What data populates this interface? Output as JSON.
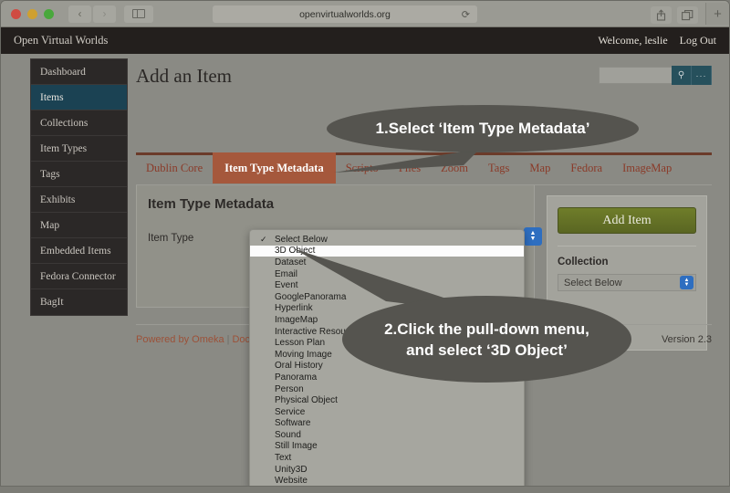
{
  "browser": {
    "url": "openvirtualworlds.org",
    "reload_icon": "reload-icon",
    "back_icon": "‹",
    "forward_icon": "›",
    "sidebar_icon": "sidebar-icon",
    "share_icon": "share-icon",
    "tabs_icon": "tabs-icon",
    "newtab_icon": "+"
  },
  "site_header": {
    "title": "Open Virtual Worlds",
    "welcome": "Welcome, leslie",
    "logout": "Log Out"
  },
  "sidebar": {
    "items": [
      {
        "label": "Dashboard",
        "active": false
      },
      {
        "label": "Items",
        "active": true
      },
      {
        "label": "Collections",
        "active": false
      },
      {
        "label": "Item Types",
        "active": false
      },
      {
        "label": "Tags",
        "active": false
      },
      {
        "label": "Exhibits",
        "active": false
      },
      {
        "label": "Map",
        "active": false
      },
      {
        "label": "Embedded Items",
        "active": false
      },
      {
        "label": "Fedora Connector",
        "active": false
      },
      {
        "label": "BagIt",
        "active": false
      }
    ]
  },
  "main": {
    "page_title": "Add an Item",
    "search": {
      "value": "",
      "placeholder": "",
      "search_icon": "search-icon",
      "advanced_label": "···"
    },
    "tabs": [
      {
        "label": "Dublin Core",
        "active": false
      },
      {
        "label": "Item Type Metadata",
        "active": true
      },
      {
        "label": "Scripto",
        "active": false
      },
      {
        "label": "Files",
        "active": false
      },
      {
        "label": "Zoom",
        "active": false
      },
      {
        "label": "Tags",
        "active": false
      },
      {
        "label": "Map",
        "active": false
      },
      {
        "label": "Fedora",
        "active": false
      },
      {
        "label": "ImageMap",
        "active": false
      }
    ],
    "panel": {
      "title": "Item Type Metadata",
      "field_label": "Item Type",
      "field_value": "Select Below"
    }
  },
  "side_panel": {
    "add_item_label": "Add Item",
    "collection_label": "Collection",
    "collection_value": "Select Below"
  },
  "footer": {
    "powered_by": "Powered by Omeka",
    "separator": "|",
    "documentation": "Docu",
    "version": "Version 2.3"
  },
  "dropdown": {
    "items": [
      {
        "label": "Select Below",
        "checked": true,
        "highlight": false
      },
      {
        "label": "3D Object",
        "checked": false,
        "highlight": true
      },
      {
        "label": "Dataset",
        "checked": false,
        "highlight": false
      },
      {
        "label": "Email",
        "checked": false,
        "highlight": false
      },
      {
        "label": "Event",
        "checked": false,
        "highlight": false
      },
      {
        "label": "GooglePanorama",
        "checked": false,
        "highlight": false
      },
      {
        "label": "Hyperlink",
        "checked": false,
        "highlight": false
      },
      {
        "label": "ImageMap",
        "checked": false,
        "highlight": false
      },
      {
        "label": "Interactive Resource",
        "checked": false,
        "highlight": false
      },
      {
        "label": "Lesson Plan",
        "checked": false,
        "highlight": false
      },
      {
        "label": "Moving Image",
        "checked": false,
        "highlight": false
      },
      {
        "label": "Oral History",
        "checked": false,
        "highlight": false
      },
      {
        "label": "Panorama",
        "checked": false,
        "highlight": false
      },
      {
        "label": "Person",
        "checked": false,
        "highlight": false
      },
      {
        "label": "Physical Object",
        "checked": false,
        "highlight": false
      },
      {
        "label": "Service",
        "checked": false,
        "highlight": false
      },
      {
        "label": "Software",
        "checked": false,
        "highlight": false
      },
      {
        "label": "Sound",
        "checked": false,
        "highlight": false
      },
      {
        "label": "Still Image",
        "checked": false,
        "highlight": false
      },
      {
        "label": "Text",
        "checked": false,
        "highlight": false
      },
      {
        "label": "Unity3D",
        "checked": false,
        "highlight": false
      },
      {
        "label": "Website",
        "checked": false,
        "highlight": false
      }
    ],
    "check_glyph": "✓"
  },
  "callouts": [
    {
      "id": "bubble1",
      "text": "1.Select ‘Item Type Metadata’"
    },
    {
      "id": "bubble2",
      "line1": "2.Click the pull-down menu,",
      "line2": "and select ‘3D Object’"
    }
  ],
  "colors": {
    "bubble_fill": "#55544f",
    "accent_orange": "#a5583c",
    "accent_green": "#6f7d2a",
    "active_nav": "#1b4253",
    "select_blue": "#2e6ec0"
  }
}
